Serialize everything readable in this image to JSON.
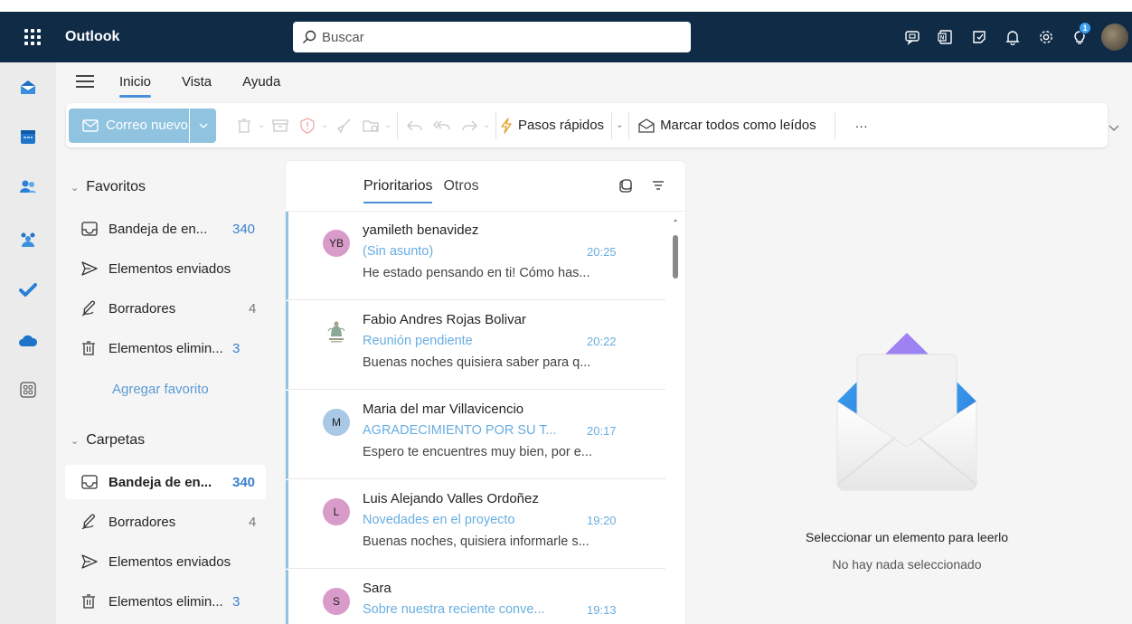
{
  "app": {
    "name": "Outlook"
  },
  "search": {
    "placeholder": "Buscar"
  },
  "header": {
    "notification_count": "1"
  },
  "ribbon": {
    "tabs": [
      "Inicio",
      "Vista",
      "Ayuda"
    ],
    "new_mail": "Correo nuevo",
    "quick_steps": "Pasos rápidos",
    "mark_all_read": "Marcar todos como leídos",
    "more": "···"
  },
  "folders": {
    "favorites_title": "Favoritos",
    "favorites": [
      {
        "name": "Bandeja de en...",
        "count": "340",
        "icon": "inbox-icon"
      },
      {
        "name": "Elementos enviados",
        "count": "",
        "icon": "send-icon"
      },
      {
        "name": "Borradores",
        "count": "4",
        "icon": "draft-icon"
      },
      {
        "name": "Elementos elimin...",
        "count": "3",
        "icon": "trash-icon"
      }
    ],
    "add_favorite": "Agregar favorito",
    "folders_title": "Carpetas",
    "folders": [
      {
        "name": "Bandeja de en...",
        "count": "340",
        "icon": "inbox-icon",
        "selected": true
      },
      {
        "name": "Borradores",
        "count": "4",
        "icon": "draft-icon"
      },
      {
        "name": "Elementos enviados",
        "count": "",
        "icon": "send-icon"
      },
      {
        "name": "Elementos elimin...",
        "count": "3",
        "icon": "trash-icon"
      }
    ]
  },
  "message_list": {
    "tabs": [
      "Prioritarios",
      "Otros"
    ],
    "messages": [
      {
        "initials": "YB",
        "avatar_color": "#d99bc9",
        "sender": "yamileth benavidez",
        "subject": "(Sin asunto)",
        "time": "20:25",
        "preview": "He estado pensando en ti! Cómo has..."
      },
      {
        "initials": "",
        "avatar_color": "#ffffff",
        "sender": "Fabio Andres Rojas Bolivar",
        "subject": "Reunión pendiente",
        "time": "20:22",
        "preview": "Buenas noches quisiera saber para q..."
      },
      {
        "initials": "M",
        "avatar_color": "#a9c8e6",
        "sender": "Maria del mar Villavicencio",
        "subject": "AGRADECIMIENTO POR SU T...",
        "time": "20:17",
        "preview": "Espero te encuentres muy bien, por e..."
      },
      {
        "initials": "L",
        "avatar_color": "#d99bc9",
        "sender": "Luis Alejando Valles Ordoñez",
        "subject": "Novedades en el proyecto",
        "time": "19:20",
        "preview": "Buenas noches, quisiera informarle s..."
      },
      {
        "initials": "S",
        "avatar_color": "#d99bc9",
        "sender": "Sara",
        "subject": "Sobre nuestra reciente conve...",
        "time": "19:13",
        "preview": ""
      }
    ]
  },
  "reading_pane": {
    "title": "Seleccionar un elemento para leerlo",
    "subtitle": "No hay nada seleccionado"
  },
  "colors": {
    "header_bg": "#0f2b46",
    "accent": "#4a8fd8",
    "new_mail_bg": "#8fc3e0",
    "unread_blue": "#68aee0"
  }
}
